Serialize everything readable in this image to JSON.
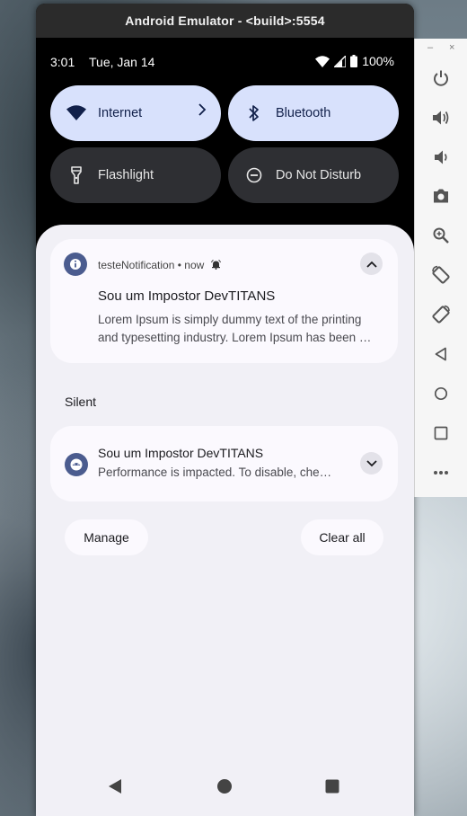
{
  "window": {
    "title": "Android Emulator - <build>:5554"
  },
  "status_bar": {
    "time": "3:01",
    "date": "Tue, Jan 14",
    "battery": "100%"
  },
  "quick_settings": [
    {
      "label": "Internet",
      "icon": "wifi-icon",
      "state": "on"
    },
    {
      "label": "Bluetooth",
      "icon": "bluetooth-icon",
      "state": "on"
    },
    {
      "label": "Flashlight",
      "icon": "flashlight-icon",
      "state": "off"
    },
    {
      "label": "Do Not Disturb",
      "icon": "do-not-disturb-icon",
      "state": "off"
    }
  ],
  "notifications": {
    "expanded": {
      "app": "testeNotification",
      "time": "now",
      "title": "Sou um Impostor DevTITANS",
      "line1": "Lorem Ipsum is simply dummy text of the printing",
      "line2": "and typesetting industry. Lorem Ipsum has been …"
    },
    "silent_label": "Silent",
    "silent": {
      "title": "Sou um Impostor DevTITANS",
      "text": "Performance is impacted. To disable, che…"
    }
  },
  "actions": {
    "manage": "Manage",
    "clear_all": "Clear all"
  },
  "side_toolbar": {
    "window_controls": [
      "–",
      "×"
    ],
    "buttons": [
      "power-icon",
      "volume-up-icon",
      "volume-down-icon",
      "camera-icon",
      "zoom-icon",
      "rotate-left-icon",
      "rotate-right-icon",
      "back-icon",
      "home-icon",
      "overview-icon",
      "more-icon"
    ]
  },
  "colors": {
    "tile_on": "#d8e1fc",
    "tile_off": "#2e2f33",
    "shade": "#f1f0f6",
    "accent": "#4b5c8f"
  }
}
